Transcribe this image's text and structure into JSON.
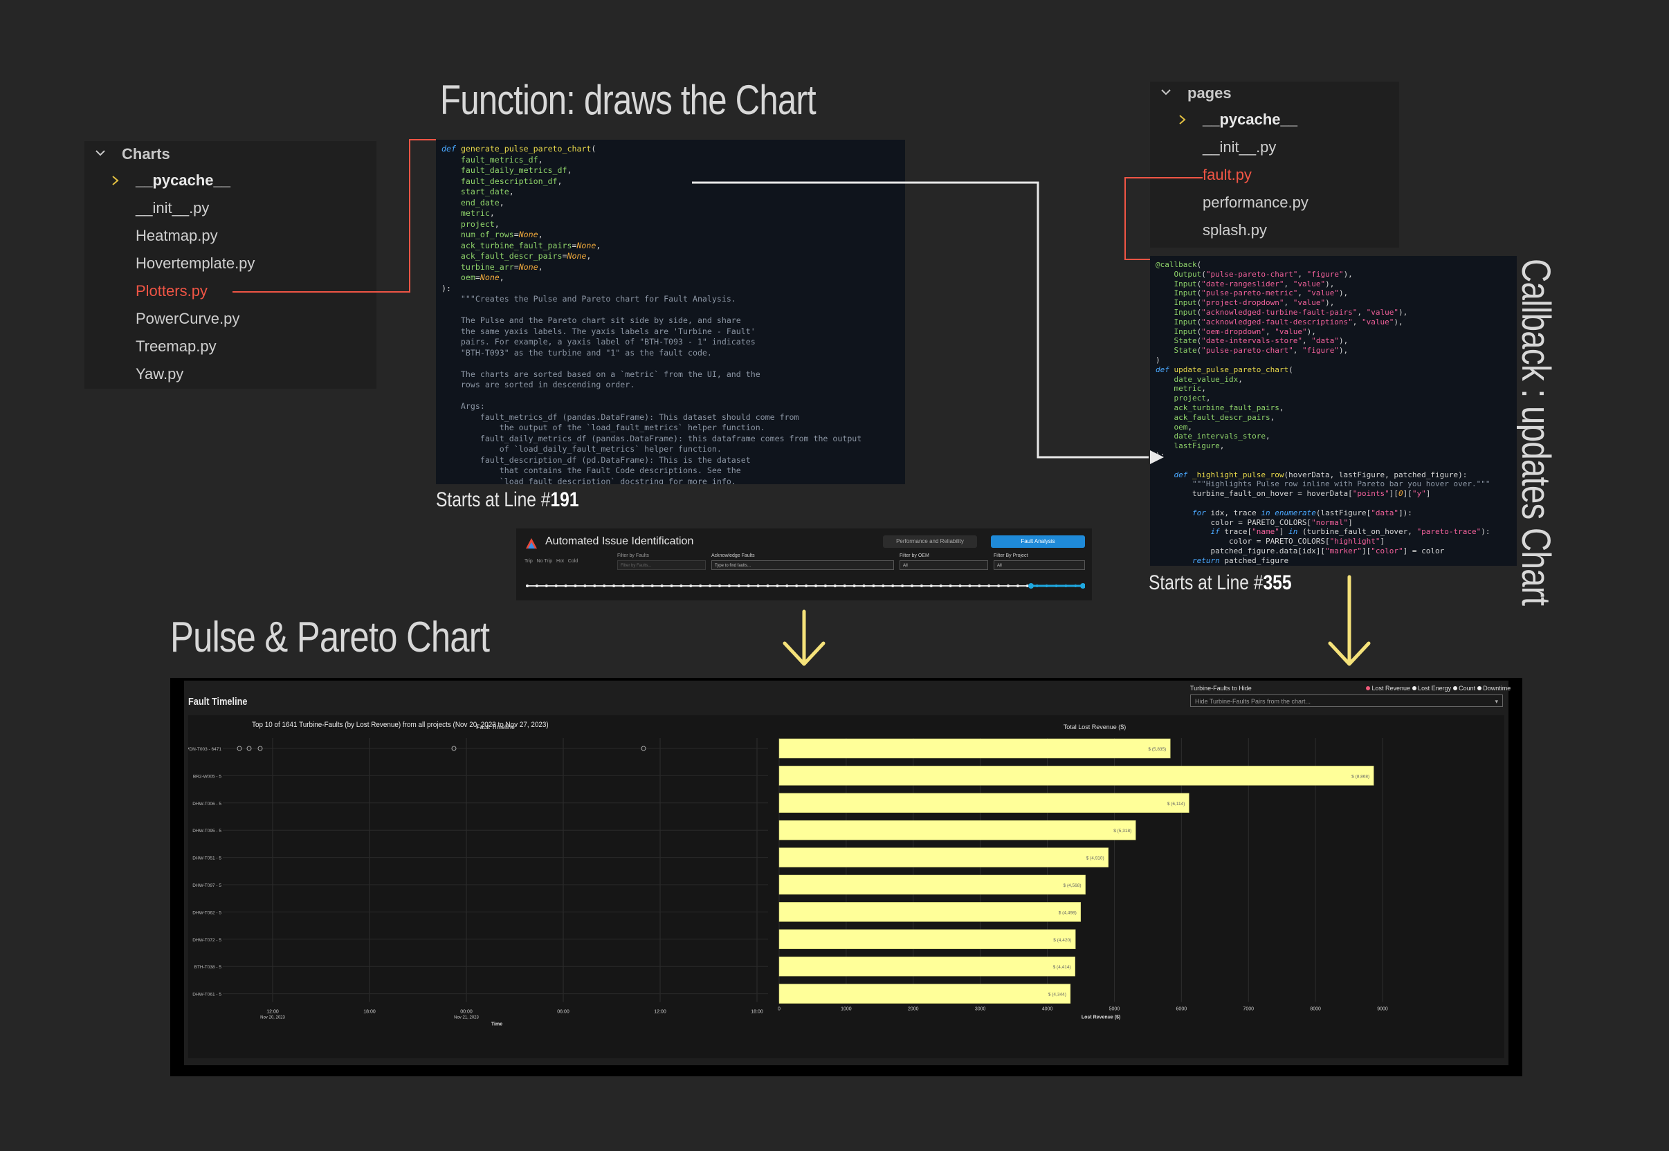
{
  "headings": {
    "function": "Function: draws the Chart",
    "pulse": "Pulse & Pareto Chart",
    "callback": "Callback : updates Chart"
  },
  "starts": {
    "func_prefix": "Starts at Line #",
    "func_line": "191",
    "callback_prefix": "Starts at Line #",
    "callback_line": "355"
  },
  "charts_explorer": {
    "folder": "Charts",
    "items": [
      "__pycache__",
      "__init__.py",
      "Heatmap.py",
      "Hovertemplate.py",
      "Plotters.py",
      "PowerCurve.py",
      "Treemap.py",
      "Yaw.py"
    ]
  },
  "pages_explorer": {
    "folder": "pages",
    "items": [
      "__pycache__",
      "__init__.py",
      "fault.py",
      "performance.py",
      "splash.py"
    ]
  },
  "app_header": {
    "title": "Automated Issue Identification",
    "tab_performance": "Performance and Reliability",
    "tab_fault": "Fault Analysis",
    "legend_trip": "Trip",
    "legend_no_trip": "No Trip",
    "legend_hot": "Hot",
    "legend_cold": "Cold",
    "filter_faults_label": "Filter by Faults",
    "filter_faults_placeholder": "Filter by Faults...",
    "ack_label": "Acknowledge Faults",
    "ack_placeholder": "Type to find faults...",
    "oem_label": "Filter by OEM",
    "oem_value": "All",
    "project_label": "Filter By Project",
    "project_value": "All"
  },
  "chart_panel": {
    "section_title": "Fault Timeline",
    "hide_label": "Turbine-Faults to Hide",
    "hide_placeholder": "Hide Turbine-Faults Pairs from the chart...",
    "radio_options": [
      "Lost Revenue",
      "Lost Energy",
      "Count",
      "Downtime"
    ],
    "selected_radio": "Lost Revenue",
    "subtitle": "Top 10 of 1641 Turbine-Faults (by Lost Revenue) from all projects (Nov 20, 2023 to Nov 27, 2023)",
    "timeline_title": "Fault Timeline",
    "pareto_title": "Total Lost Revenue ($)"
  },
  "chart_data": [
    {
      "type": "scatter",
      "title": "Fault Timeline",
      "xlabel": "Time",
      "ylabel": "",
      "x_ticks": [
        "12:00\nNov 20, 2023",
        "18:00",
        "00:00\nNov 21, 2023",
        "06:00",
        "12:00",
        "18:00"
      ],
      "categories": [
        "PDN-T003 - 6471",
        "BR2-W005 - 5",
        "DHW-T006 - 5",
        "DHW-T095 - 5",
        "DHW-T051 - 5",
        "DHW-T097 - 5",
        "DHW-T062 - 5",
        "DHW-T072 - 5",
        "BTH-T038 - 5",
        "DHW-T061 - 5"
      ]
    },
    {
      "type": "bar",
      "orientation": "horizontal",
      "title": "Total Lost Revenue ($)",
      "xlabel": "Lost Revenue ($)",
      "categories": [
        "PDN-T003 - 6471",
        "BR2-W005 - 5",
        "DHW-T006 - 5",
        "DHW-T095 - 5",
        "DHW-T051 - 5",
        "DHW-T097 - 5",
        "DHW-T062 - 5",
        "DHW-T072 - 5",
        "BTH-T038 - 5",
        "DHW-T061 - 5"
      ],
      "values": [
        5835,
        8868,
        6114,
        5318,
        4910,
        4568,
        4498,
        4420,
        4414,
        4344
      ],
      "labels": [
        "$ (5,835)",
        "$ (8,868)",
        "$ (6,114)",
        "$ (5,318)",
        "$ (4,910)",
        "$ (4,568)",
        "$ (4,498)",
        "$ (4,420)",
        "$ (4,414)",
        "$ (4,344)"
      ],
      "x_ticks": [
        "0",
        "1000",
        "2000",
        "3000",
        "4000",
        "5000",
        "6000",
        "7000",
        "8000",
        "9000"
      ],
      "xlim": [
        0,
        9000
      ],
      "bar_color": "#ffff99"
    }
  ],
  "colors": {
    "background": "#262626",
    "accent_red": "#f05545",
    "arrow_yellow": "#f5e27a",
    "tab_active": "#1f8ad8",
    "bar": "#ffff99"
  }
}
